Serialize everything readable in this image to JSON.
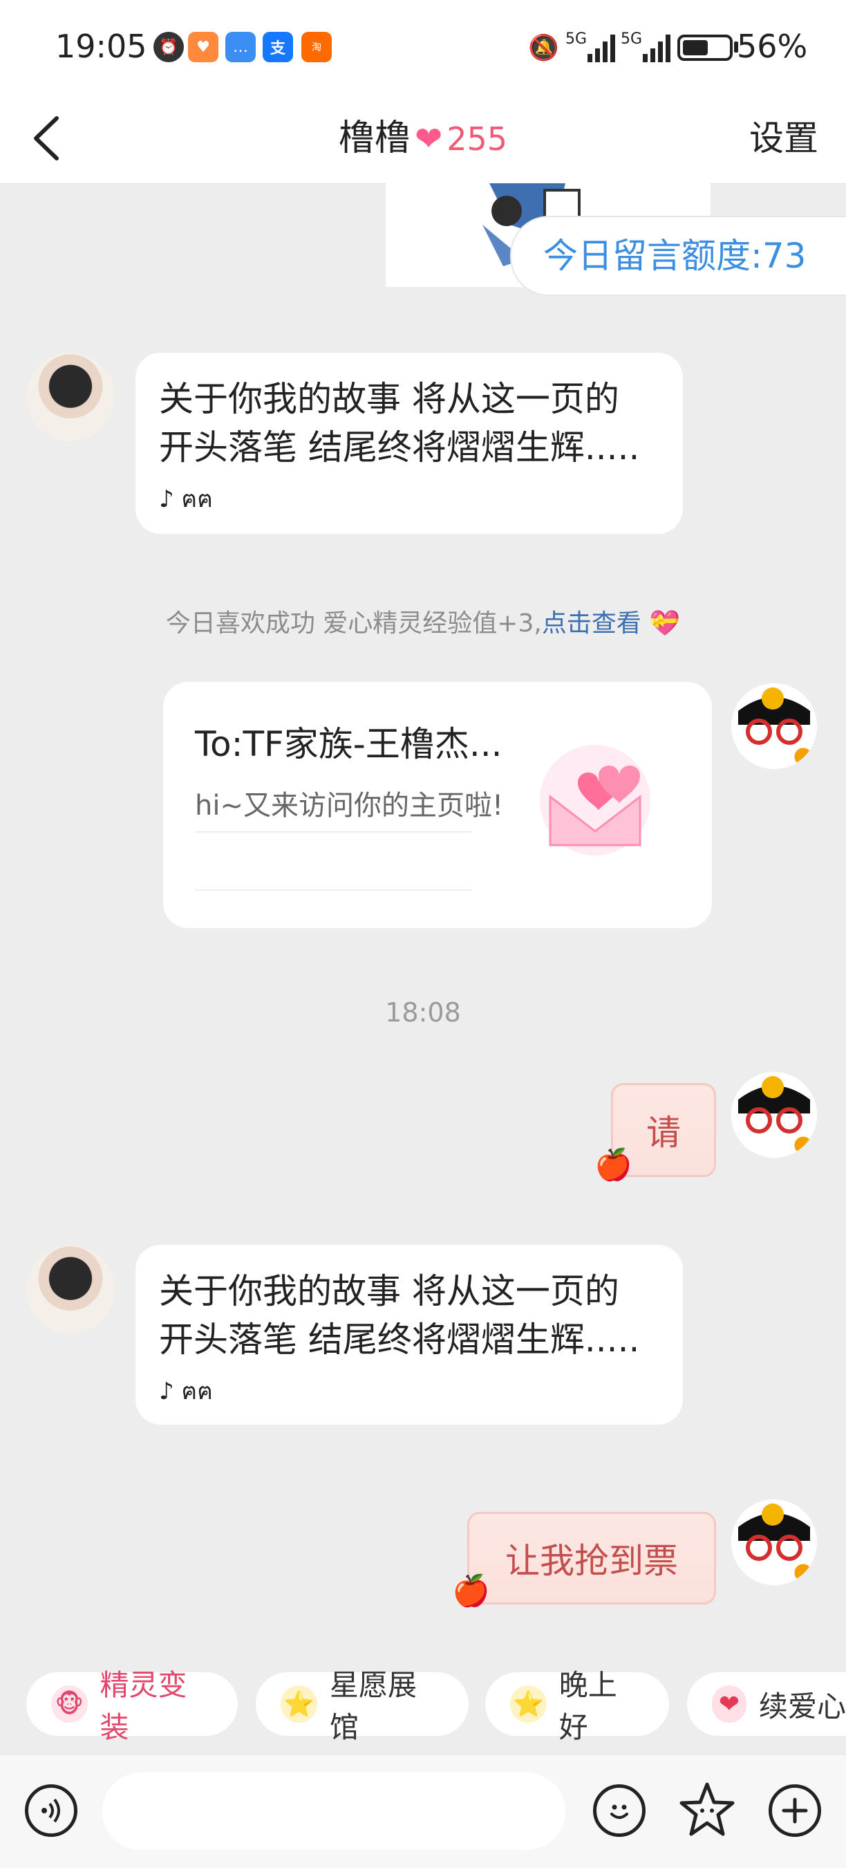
{
  "status_bar": {
    "time": "19:05",
    "battery": "56%",
    "net1": "5G",
    "net2": "5G"
  },
  "header": {
    "title": "橹橹",
    "heart": "❤",
    "score": "255",
    "settings": "设置"
  },
  "quota": "今日留言额度:73",
  "messages": [
    {
      "line1": "关于你我的故事  将从这一页的",
      "line2": "开头落笔  结尾终将熠熠生辉.....",
      "music": "ฅฅ"
    },
    {
      "line1": "关于你我的故事  将从这一页的",
      "line2": "开头落笔  结尾终将熠熠生辉.....",
      "music": "ฅฅ"
    }
  ],
  "notice": {
    "text": "今日喜欢成功 爱心精灵经验值+3,",
    "link": "点击查看"
  },
  "card": {
    "title": "To:TF家族-王橹杰...",
    "subtitle": "hi~又来访问你的主页啦!"
  },
  "timestamp": "18:08",
  "stickers": [
    "请",
    "让我抢到票"
  ],
  "chips": [
    {
      "label": "精灵变装",
      "color": "#e0476a"
    },
    {
      "label": "星愿展馆",
      "color": "#333333"
    },
    {
      "label": "晚上好",
      "color": "#333333"
    },
    {
      "label": "续爱心",
      "color": "#333333"
    }
  ]
}
